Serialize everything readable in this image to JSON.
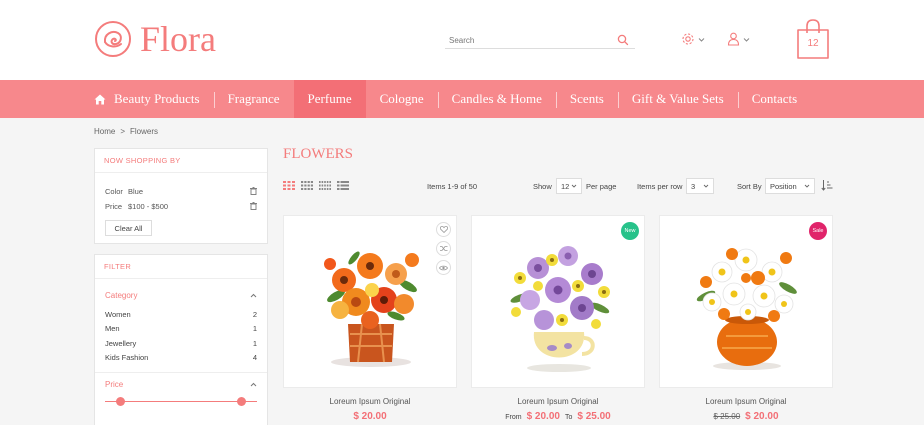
{
  "brand": {
    "name": "Flora",
    "color": "#f47c7c"
  },
  "search": {
    "placeholder": "Search"
  },
  "cart": {
    "count": "12"
  },
  "nav": {
    "items": [
      {
        "label": "Beauty Products"
      },
      {
        "label": "Fragrance"
      },
      {
        "label": "Perfume",
        "active": true
      },
      {
        "label": "Cologne"
      },
      {
        "label": "Candles & Home"
      },
      {
        "label": "Scents"
      },
      {
        "label": "Gift & Value Sets"
      },
      {
        "label": "Contacts"
      }
    ],
    "bg_color": "#f7888c",
    "active_color": "#f36f76"
  },
  "breadcrumb": {
    "home": "Home",
    "sep": ">",
    "current": "Flowers"
  },
  "shopping_by": {
    "title": "Now Shopping By",
    "filters": [
      {
        "label": "Color",
        "value": "Blue"
      },
      {
        "label": "Price",
        "value": "$100 - $500"
      }
    ],
    "clear_label": "Clear All"
  },
  "filter": {
    "title": "Filter",
    "category_title": "Category",
    "categories": [
      {
        "name": "Women",
        "count": "2"
      },
      {
        "name": "Men",
        "count": "1"
      },
      {
        "name": "Jewellery",
        "count": "1"
      },
      {
        "name": "Kids Fashion",
        "count": "4"
      }
    ],
    "price_title": "Price",
    "price_range": [
      0.1,
      0.9
    ]
  },
  "main": {
    "title": "FLOWERS",
    "items_count": "Items 1-9 of 50",
    "show_label": "Show",
    "show_value": "12",
    "per_page_label": "Per page",
    "items_per_row_label": "Items per row",
    "items_per_row_value": "3",
    "sort_label": "Sort By",
    "sort_value": "Position"
  },
  "products": [
    {
      "name": "Loreum Ipsum Original",
      "price": "$ 20.00"
    },
    {
      "name": "Loreum Ipsum Original",
      "badge": "New",
      "badge_color": "#27c28a",
      "from_label": "From",
      "price_from": "$ 20.00",
      "to_label": "To",
      "price_to": "$ 25.00"
    },
    {
      "name": "Loreum Ipsum Original",
      "badge": "Sale",
      "badge_color": "#e0246a",
      "old_price": "$ 25.00",
      "price": "$ 20.00"
    }
  ]
}
